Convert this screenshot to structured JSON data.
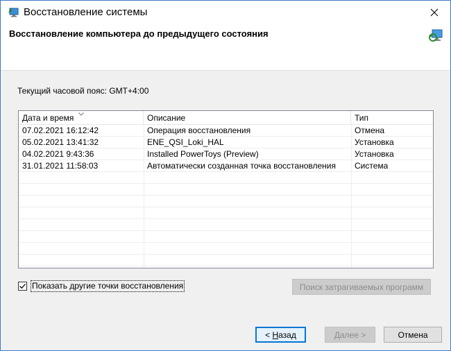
{
  "window": {
    "title": "Восстановление системы",
    "close_glyph": "✕"
  },
  "header": {
    "heading": "Восстановление компьютера до предыдущего состояния"
  },
  "timezone_text": "Текущий часовой пояс: GMT+4:00",
  "list": {
    "columns": [
      "Дата и время",
      "Описание",
      "Тип"
    ],
    "rows": [
      {
        "date": "07.02.2021 16:12:42",
        "description": "Операция восстановления",
        "type": "Отмена"
      },
      {
        "date": "05.02.2021 13:41:32",
        "description": "ENE_QSI_Loki_HAL",
        "type": "Установка"
      },
      {
        "date": "04.02.2021 9:43:36",
        "description": "Installed PowerToys (Preview)",
        "type": "Установка"
      },
      {
        "date": "31.01.2021 11:58:03",
        "description": "Автоматически созданная точка восстановления",
        "type": "Система"
      }
    ]
  },
  "show_more": {
    "label": "Показать другие точки восстановления",
    "checked": true
  },
  "buttons": {
    "scan": "Поиск затрагиваемых программ",
    "back_prefix": "< ",
    "back_mnemonic": "Н",
    "back_rest": "азад",
    "next": "Далее >",
    "cancel": "Отмена"
  },
  "colors": {
    "accent": "#0078d7",
    "window_border": "#3c7ac8"
  },
  "icons": {
    "app": "system-restore-icon",
    "header": "system-restore-icon",
    "close": "close-icon",
    "sort": "sort-arrow-icon",
    "check": "checkmark-icon"
  }
}
